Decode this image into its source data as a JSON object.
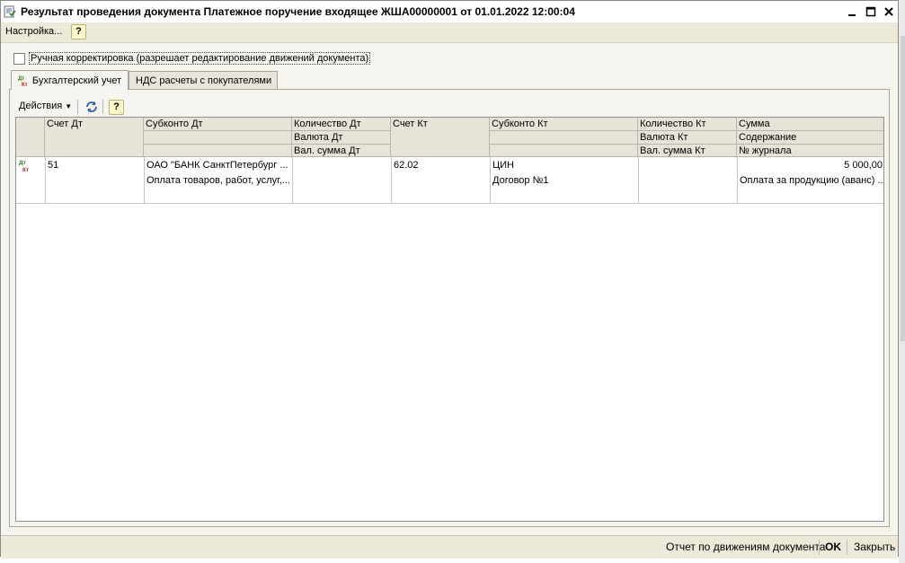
{
  "window": {
    "title": "Результат проведения документа Платежное поручение входящее ЖША00000001 от 01.01.2022 12:00:04"
  },
  "menu": {
    "settings_label": "Настройка...",
    "help_label": "?"
  },
  "manual_edit": {
    "label": "Ручная корректировка (разрешает редактирование движений документа)",
    "checked": false
  },
  "tabs": [
    {
      "label": "Бухгалтерский учет",
      "active": true
    },
    {
      "label": "НДС расчеты с покупателями",
      "active": false
    }
  ],
  "toolbar": {
    "actions_label": "Действия",
    "help_label": "?"
  },
  "table": {
    "headers": {
      "schet_dt": "Счет Дт",
      "subkonto_dt": "Субконто Дт",
      "kolichestvo_dt": "Количество Дт",
      "valyuta_dt": "Валюта Дт",
      "val_summa_dt": "Вал. сумма Дт",
      "schet_kt": "Счет Кт",
      "subkonto_kt": "Субконто Кт",
      "kolichestvo_kt": "Количество Кт",
      "valyuta_kt": "Валюта Кт",
      "val_summa_kt": "Вал. сумма Кт",
      "summa": "Сумма",
      "soderzhanie": "Содержание",
      "nomer_zhurnala": "№ журнала"
    },
    "rows": [
      {
        "icon_dt": "Дт",
        "icon_kt": "Кт",
        "schet_dt": "51",
        "subkonto_dt_1": "ОАО \"БАНК СанктПетербург ...",
        "subkonto_dt_2": "Оплата товаров, работ, услуг,...",
        "schet_kt": "62.02",
        "subkonto_kt_1": "ЦИН",
        "subkonto_kt_2": "Договор №1",
        "summa": "5 000,00",
        "soderzhanie": "Оплата за продукцию (аванс) ..."
      }
    ]
  },
  "bottom": {
    "report_label": "Отчет по движениям документа",
    "ok_label": "OK",
    "close_label": "Закрыть"
  },
  "colors": {
    "window_bg": "#ece9d8",
    "header_bg": "#e6e3d9",
    "icon_dt": "#2f7d1e",
    "icon_kt": "#c0201b"
  }
}
